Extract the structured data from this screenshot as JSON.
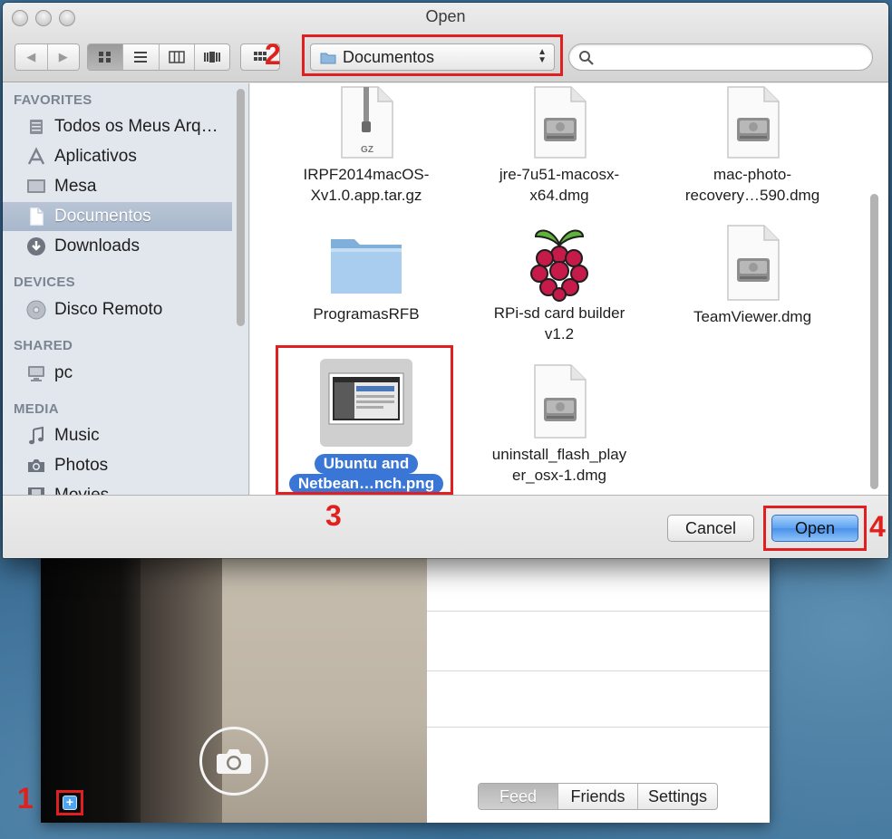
{
  "dialog": {
    "title": "Open",
    "location": "Documentos",
    "search_placeholder": "",
    "cancel_label": "Cancel",
    "open_label": "Open"
  },
  "sidebar": {
    "sections": [
      {
        "title": "FAVORITES",
        "items": [
          {
            "label": "Todos os Meus Arq…",
            "icon": "all-files-icon"
          },
          {
            "label": "Aplicativos",
            "icon": "applications-icon"
          },
          {
            "label": "Mesa",
            "icon": "desktop-icon"
          },
          {
            "label": "Documentos",
            "icon": "documents-icon",
            "selected": true
          },
          {
            "label": "Downloads",
            "icon": "downloads-icon"
          }
        ]
      },
      {
        "title": "DEVICES",
        "items": [
          {
            "label": "Disco Remoto",
            "icon": "remote-disc-icon"
          }
        ]
      },
      {
        "title": "SHARED",
        "items": [
          {
            "label": "pc",
            "icon": "computer-icon"
          }
        ]
      },
      {
        "title": "MEDIA",
        "items": [
          {
            "label": "Music",
            "icon": "music-icon"
          },
          {
            "label": "Photos",
            "icon": "camera-icon"
          },
          {
            "label": "Movies",
            "icon": "film-icon"
          }
        ]
      }
    ]
  },
  "files": [
    {
      "line1": "IRPF2014macOS-",
      "line2": "Xv1.0.app.tar.gz",
      "icon": "archive-icon",
      "badge": "GZ"
    },
    {
      "line1": "jre-7u51-macosx-",
      "line2": "x64.dmg",
      "icon": "disk-image-icon"
    },
    {
      "line1": "mac-photo-",
      "line2": "recovery…590.dmg",
      "icon": "disk-image-icon"
    },
    {
      "line1": "ProgramasRFB",
      "line2": "",
      "icon": "folder-icon"
    },
    {
      "line1": "RPi-sd card builder",
      "line2": "v1.2",
      "icon": "raspberry-icon"
    },
    {
      "line1": "TeamViewer.dmg",
      "line2": "",
      "icon": "disk-image-icon"
    },
    {
      "line1": "Ubuntu and",
      "line2": "Netbean…nch.png",
      "icon": "image-thumbnail-icon",
      "selected": true
    },
    {
      "line1": "uninstall_flash_play",
      "line2": "er_osx-1.dmg",
      "icon": "disk-image-icon"
    }
  ],
  "app": {
    "tabs": [
      "Feed",
      "Friends",
      "Settings"
    ],
    "active_tab": "Feed"
  },
  "steps": [
    "1",
    "2",
    "3",
    "4"
  ],
  "colors": {
    "highlight_red": "#e02020",
    "selection_blue": "#3976d6",
    "sidebar_bg": "#e2e7ee"
  }
}
